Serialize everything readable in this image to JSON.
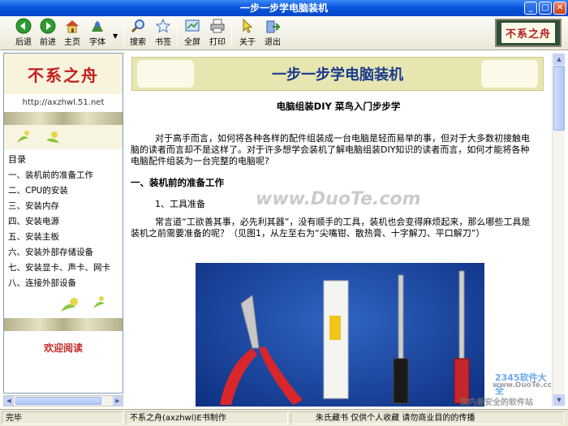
{
  "window": {
    "title": "一步一步学电脑装机"
  },
  "toolbar": {
    "buttons": [
      {
        "label": "后退",
        "icon": "back-arrow-icon"
      },
      {
        "label": "前进",
        "icon": "forward-arrow-icon"
      },
      {
        "label": "主页",
        "icon": "home-icon"
      },
      {
        "label": "字体",
        "icon": "font-icon"
      },
      {
        "label": "搜索",
        "icon": "search-icon"
      },
      {
        "label": "书签",
        "icon": "star-icon"
      },
      {
        "label": "全屏",
        "icon": "fullscreen-icon"
      },
      {
        "label": "打印",
        "icon": "printer-icon"
      },
      {
        "label": "关于",
        "icon": "cursor-icon"
      },
      {
        "label": "退出",
        "icon": "exit-icon"
      }
    ],
    "brand_logo": "不系之舟"
  },
  "sidebar": {
    "logo_text": "不系之舟",
    "url": "http://axzhwl.51.net",
    "menu_title": "目录",
    "items": [
      "一、装机前的准备工作",
      "二、CPU的安装",
      "三、安装内存",
      "四、安装电源",
      "五、安装主板",
      "六、安装外部存储设备",
      "七、安装显卡、声卡、网卡",
      "八、连接外部设备"
    ],
    "welcome": "欢迎阅读"
  },
  "content": {
    "banner_title": "一步一步学电脑装机",
    "subtitle": "电脑组装DIY 菜鸟入门步步学",
    "intro": "对于高手而言，如何将各种各样的配件组装成一台电脑是轻而易举的事，但对于大多数初接触电脑的读者而言却不是这样了。对于许多想学会装机了解电脑组装DIY知识的读者而言，如何才能将各种电脑配件组装为一台完整的电脑呢?",
    "section1": "一、装机前的准备工作",
    "subsection1": "1、工具准备",
    "para2": "常言道“工欲善其事，必先利其器”，没有顺手的工具，装机也会变得麻烦起来，那么哪些工具是装机之前需要准备的呢？（见图1，从左至右为“尖嘴钳、散热膏、十字解刀、平口解刀”）"
  },
  "statusbar": {
    "status": "完毕",
    "author": "不系之舟(axzhwl)E书制作",
    "notice": "朱氏藏书 仅供个人收藏 请勿商业目的的传播"
  },
  "watermarks": {
    "center": "www.DuoTe.com",
    "corner_brand": "2345软件大全",
    "corner_slogan": "国内最安全的软件站",
    "corner_url": "www.DuoTe.com"
  },
  "colors": {
    "titlebar": "#0855dd",
    "banner_title": "#1b3a8e",
    "logo_red": "#c32020"
  }
}
